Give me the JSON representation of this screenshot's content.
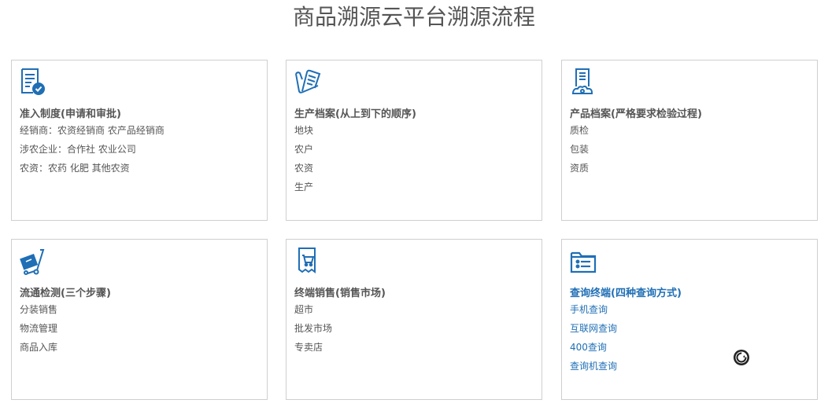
{
  "page": {
    "title": "商品溯源云平台溯源流程"
  },
  "colors": {
    "icon_blue": "#1f6fb5",
    "text": "#555555",
    "border": "#cfcfcf"
  },
  "cards": [
    {
      "icon": "document-check-icon",
      "title": "准入制度(申请和审批)",
      "items": [
        "经销商：农资经销商 农产品经销商",
        "涉农企业：合作社 农业公司",
        "农资：农药 化肥 其他农资"
      ]
    },
    {
      "icon": "paper-scroll-icon",
      "title": "生产档案(从上到下的顺序)",
      "items": [
        "地块",
        "农户",
        "农资",
        "生产"
      ]
    },
    {
      "icon": "document-gear-icon",
      "title": "产品档案(严格要求检验过程)",
      "items": [
        "质检",
        "包装",
        "资质"
      ]
    },
    {
      "icon": "hand-truck-icon",
      "title": "流通检测(三个步骤)",
      "items": [
        "分装销售",
        "物流管理",
        "商品入库"
      ]
    },
    {
      "icon": "receipt-cart-icon",
      "title": "终端销售(销售市场)",
      "items": [
        "超市",
        "批发市场",
        "专卖店"
      ]
    },
    {
      "icon": "folder-list-icon",
      "title": "查询终端(四种查询方式)",
      "items": [
        "手机查询",
        "互联网查询",
        "400查询",
        "查询机查询"
      ]
    }
  ]
}
